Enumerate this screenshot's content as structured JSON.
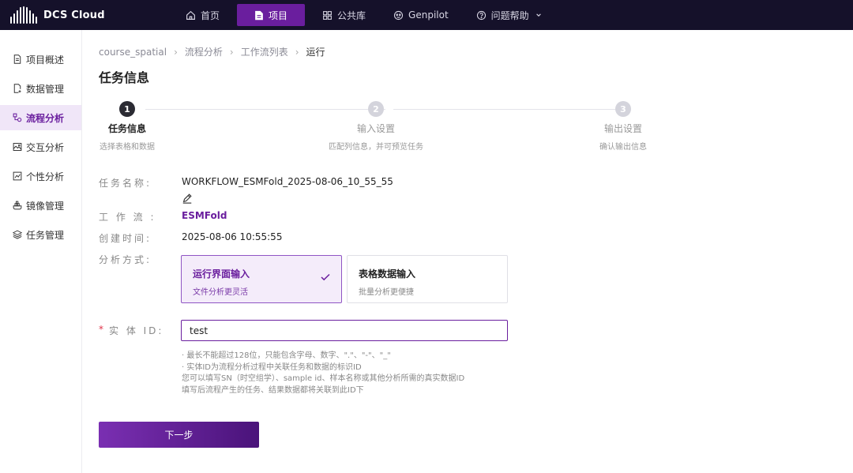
{
  "app": {
    "logo_text": "DCS Cloud"
  },
  "nav": [
    {
      "label": "首页",
      "icon": "home-icon",
      "active": false
    },
    {
      "label": "项目",
      "icon": "document-icon",
      "active": true
    },
    {
      "label": "公共库",
      "icon": "grid-icon",
      "active": false
    },
    {
      "label": "Genpilot",
      "icon": "bot-icon",
      "active": false
    },
    {
      "label": "问题帮助",
      "icon": "help-circle-icon",
      "active": false
    }
  ],
  "sidebar": {
    "items": [
      {
        "label": "项目概述",
        "icon": "file-text-icon"
      },
      {
        "label": "数据管理",
        "icon": "file-plus-icon"
      },
      {
        "label": "流程分析",
        "icon": "flow-icon",
        "active": true
      },
      {
        "label": "交互分析",
        "icon": "image-icon"
      },
      {
        "label": "个性分析",
        "icon": "chart-box-icon"
      },
      {
        "label": "镜像管理",
        "icon": "container-icon"
      },
      {
        "label": "任务管理",
        "icon": "layers-icon"
      }
    ]
  },
  "breadcrumb": [
    "course_spatial",
    "流程分析",
    "工作流列表",
    "运行"
  ],
  "page_title": "任务信息",
  "steps": [
    {
      "number": "1",
      "title": "任务信息",
      "desc": "选择表格和数据",
      "state": "done"
    },
    {
      "number": "2",
      "title": "输入设置",
      "desc": "匹配列信息，并可预览任务",
      "state": "todo"
    },
    {
      "number": "3",
      "title": "输出设置",
      "desc": "确认输出信息",
      "state": "todo"
    }
  ],
  "form": {
    "task_name_label": "任务名称:",
    "task_name_value": "WORKFLOW_ESMFold_2025-08-06_10_55_55",
    "workflow_label": "工 作 流 :",
    "workflow_value": "ESMFold",
    "created_label": "创建时间:",
    "created_value": "2025-08-06 10:55:55",
    "mode_label": "分析方式:",
    "modes": [
      {
        "title": "运行界面输入",
        "desc": "文件分析更灵活",
        "selected": true
      },
      {
        "title": "表格数据输入",
        "desc": "批量分析更便捷",
        "selected": false
      }
    ],
    "required_mark": "*",
    "entity_label": "实 体 ID:",
    "entity_value": "test",
    "hints": [
      "· 最长不能超过128位，只能包含字母、数字、\".\"、\"-\"、\"_\"",
      "· 实体ID为流程分析过程中关联任务和数据的标识ID",
      "您可以填写SN（时空组学）、sample id、样本名称或其他分析所需的真实数据ID",
      "填写后流程产生的任务、结果数据都将关联到此ID下"
    ]
  },
  "next_button": "下一步",
  "colors": {
    "accent": "#6a1e9e",
    "topbar": "#15112a",
    "selected_bg": "#f4ecfa"
  }
}
